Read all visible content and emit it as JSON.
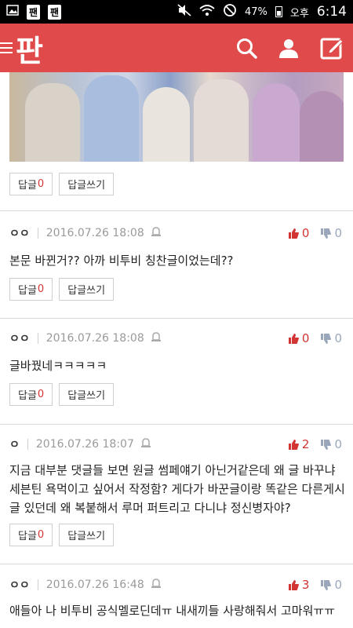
{
  "status": {
    "left_badges": [
      "팬",
      "팬"
    ],
    "battery": "47%",
    "ampm": "오후",
    "time": "6:14"
  },
  "appbar": {
    "logo": "판",
    "icons": [
      "menu-icon",
      "search-icon",
      "profile-icon",
      "write-icon"
    ],
    "accent": "#e04a4a"
  },
  "reply_labels": {
    "reply": "답글",
    "write": "답글쓰기"
  },
  "top_reply_count": "0",
  "comments": [
    {
      "nick": "ㅇㅇ",
      "date": "2016.07.26 18:08",
      "up": "0",
      "down": "0",
      "text": "본문 바뀐거?? 아까 비투비 칭찬글이었는데??",
      "reply_count": "0"
    },
    {
      "nick": "ㅇㅇ",
      "date": "2016.07.26 18:08",
      "up": "0",
      "down": "0",
      "text": "글바꿨네ㅋㅋㅋㅋㅋ",
      "reply_count": "0"
    },
    {
      "nick": "ㅇ",
      "date": "2016.07.26 18:07",
      "up": "2",
      "down": "0",
      "text": "지금 대부분 댓글들 보면 원글 썸페얘기 아닌거같은데 왜 글 바꾸냐 세븐틴 욕먹이고 싶어서 작정함? 게다가 바꾼글이랑 똑같은 다른게시글 있던데 왜 복붙해서 루머 퍼트리고 다니냐 정신병자야?",
      "reply_count": "0"
    },
    {
      "nick": "ㅇㅇ",
      "date": "2016.07.26 16:48",
      "up": "3",
      "down": "0",
      "text": "애들아 나 비투비 공식멜로딘데ㅠ 내새끼들 사랑해줘서 고마워ㅠㅠ"
    }
  ],
  "colors": {
    "up": "#d23434",
    "down": "#9aa7bb",
    "text": "#222222",
    "meta": "#9a9a9a"
  }
}
